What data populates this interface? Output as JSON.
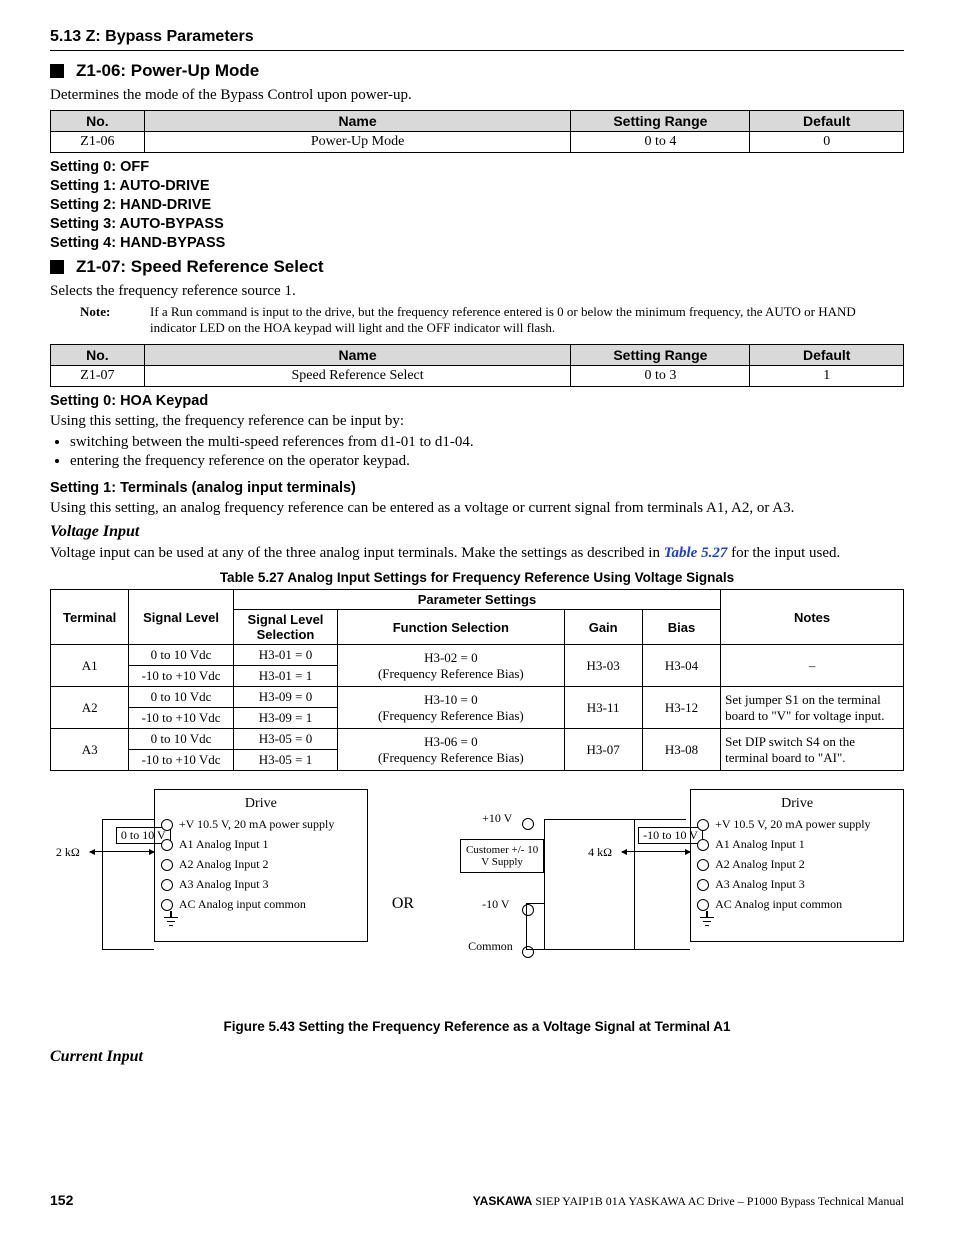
{
  "header": {
    "section": "5.13 Z: Bypass Parameters"
  },
  "z106": {
    "title": "Z1-06: Power-Up Mode",
    "desc": "Determines the mode of the Bypass Control upon power-up.",
    "table": {
      "h_no": "No.",
      "h_name": "Name",
      "h_range": "Setting Range",
      "h_default": "Default",
      "no": "Z1-06",
      "name": "Power-Up Mode",
      "range": "0 to 4",
      "default": "0"
    },
    "settings": [
      "Setting 0: OFF",
      "Setting 1: AUTO-DRIVE",
      "Setting 2: HAND-DRIVE",
      "Setting 3: AUTO-BYPASS",
      "Setting 4: HAND-BYPASS"
    ]
  },
  "z107": {
    "title": "Z1-07: Speed Reference Select",
    "desc": "Selects the frequency reference source 1.",
    "note_label": "Note:",
    "note": "If a Run command is input to the drive, but the frequency reference entered is 0 or below the minimum frequency, the AUTO or HAND indicator LED on the HOA keypad will light and the OFF indicator will flash.",
    "table": {
      "h_no": "No.",
      "h_name": "Name",
      "h_range": "Setting Range",
      "h_default": "Default",
      "no": "Z1-07",
      "name": "Speed Reference Select",
      "range": "0 to 3",
      "default": "1"
    },
    "s0": {
      "heading": "Setting 0: HOA Keypad",
      "line": "Using this setting, the frequency reference can be input by:",
      "b1": "switching between the multi-speed references from d1-01 to d1-04.",
      "b2": "entering the frequency reference on the operator keypad."
    },
    "s1": {
      "heading": "Setting 1: Terminals (analog input terminals)",
      "line": "Using this setting, an analog frequency reference can be entered as a voltage or current signal from terminals A1, A2, or A3."
    }
  },
  "voltage": {
    "heading": "Voltage Input",
    "line_a": "Voltage input can be used at any of the three analog input terminals. Make the settings as described in ",
    "link": "Table 5.27",
    "line_b": " for the input used.",
    "table_title": "Table 5.27  Analog Input Settings for Frequency Reference Using Voltage Signals",
    "th": {
      "terminal": "Terminal",
      "siglevel": "Signal Level",
      "param": "Parameter Settings",
      "slsel": "Signal Level Selection",
      "func": "Function Selection",
      "gain": "Gain",
      "bias": "Bias",
      "notes": "Notes"
    },
    "rows": {
      "a1": {
        "t": "A1",
        "r1_sl": "0 to 10 Vdc",
        "r1_sel": "H3-01 = 0",
        "r2_sl": "-10 to +10 Vdc",
        "r2_sel": "H3-01 = 1",
        "func_a": "H3-02 = 0",
        "func_b": "(Frequency Reference Bias)",
        "gain": "H3-03",
        "bias": "H3-04",
        "notes": "–"
      },
      "a2": {
        "t": "A2",
        "r1_sl": "0 to 10 Vdc",
        "r1_sel": "H3-09 = 0",
        "r2_sl": "-10 to +10 Vdc",
        "r2_sel": "H3-09 = 1",
        "func_a": "H3-10 = 0",
        "func_b": "(Frequency Reference Bias)",
        "gain": "H3-11",
        "bias": "H3-12",
        "notes": "Set jumper S1 on the terminal board to \"V\" for voltage input."
      },
      "a3": {
        "t": "A3",
        "r1_sl": "0 to 10 Vdc",
        "r1_sel": "H3-05 = 0",
        "r2_sl": "-10 to +10 Vdc",
        "r2_sel": "H3-05 = 1",
        "func_a": "H3-06 = 0",
        "func_b": "(Frequency Reference Bias)",
        "gain": "H3-07",
        "bias": "H3-08",
        "notes": "Set DIP switch S4 on the terminal board to \"AI\"."
      }
    }
  },
  "diagram": {
    "left": {
      "drive": "Drive",
      "vrange": "0 to 10 V",
      "res": "2 kΩ",
      "pv": "+V  10.5 V, 20 mA power supply",
      "a1": "A1  Analog Input 1",
      "a2": "A2  Analog Input 2",
      "a3": "A3  Analog Input 3",
      "ac": "AC  Analog input common"
    },
    "or": "OR",
    "mid": {
      "p10": "+10 V",
      "cust": "Customer +/- 10 V Supply",
      "n10": "-10 V",
      "com": "Common"
    },
    "right": {
      "drive": "Drive",
      "vrange": "-10 to 10 V",
      "res": "4 kΩ",
      "pv": "+V  10.5 V, 20 mA power supply",
      "a1": "A1  Analog Input 1",
      "a2": "A2  Analog Input 2",
      "a3": "A3  Analog Input 3",
      "ac": "AC  Analog input common"
    },
    "caption": "Figure 5.43  Setting the Frequency Reference as a Voltage Signal at Terminal A1"
  },
  "current": {
    "heading": "Current Input"
  },
  "footer": {
    "page": "152",
    "brand": "YASKAWA",
    "ref": " SIEP YAIP1B 01A YASKAWA AC Drive – P1000 Bypass Technical Manual"
  }
}
